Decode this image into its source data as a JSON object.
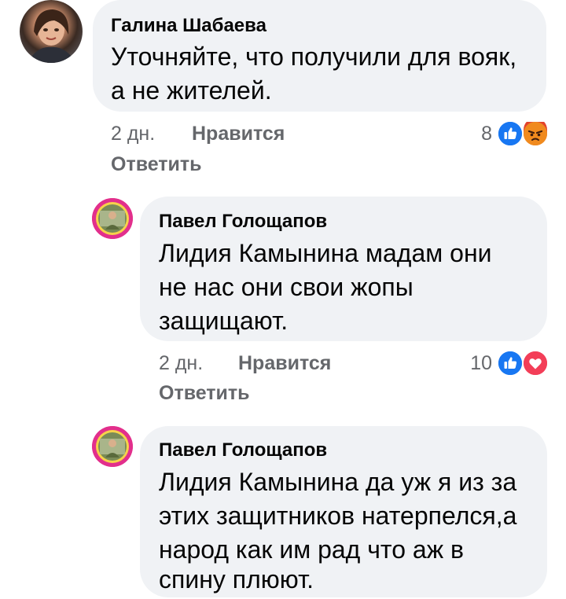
{
  "comments": [
    {
      "author": "Галина Шабаева",
      "lines": [
        "Уточняйте, что получили для вояк,",
        "а не жителей."
      ],
      "time": "2 дн.",
      "like_label": "Нравится",
      "reply_label": "Ответить",
      "reaction_count": "8",
      "reactions": [
        "like-icon",
        "angry-icon"
      ]
    },
    {
      "author": "Павел Голощапов",
      "lines": [
        "Лидия Камынина мадам они",
        "не нас они свои жопы",
        "защищают."
      ],
      "time": "2 дн.",
      "like_label": "Нравится",
      "reply_label": "Ответить",
      "reaction_count": "10",
      "reactions": [
        "like-icon",
        "love-icon"
      ]
    },
    {
      "author": "Павел Голощапов",
      "lines": [
        "Лидия Камынина да уж я из за",
        "этих защитников натерпелся,а",
        "народ как им рад что аж в",
        "спину плюют."
      ]
    }
  ],
  "colors": {
    "bubble": "#f0f2f5",
    "meta_text": "#65676b",
    "like_blue": "#1877f2",
    "love_red": "#f33e58",
    "angry_orange": "#e9710f"
  }
}
